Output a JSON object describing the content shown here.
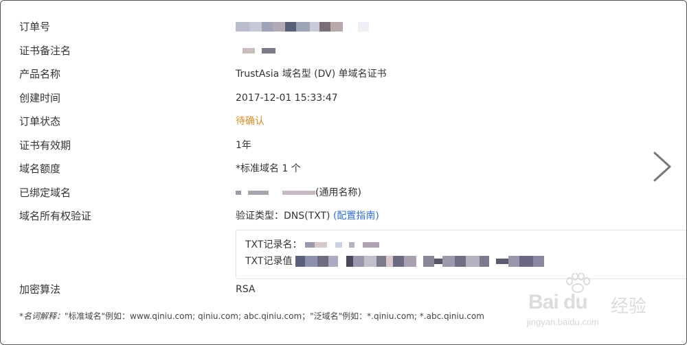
{
  "fields": {
    "order_no": {
      "label": "订单号"
    },
    "cert_note": {
      "label": "证书备注名"
    },
    "product": {
      "label": "产品名称",
      "value": "TrustAsia 域名型 (DV) 单域名证书"
    },
    "created": {
      "label": "创建时间",
      "value": "2017-12-01 15:33:47"
    },
    "status": {
      "label": "订单状态",
      "value": "待确认",
      "color": "#e08b1e"
    },
    "validity": {
      "label": "证书有效期",
      "value": "1年"
    },
    "quota": {
      "label": "域名额度",
      "value": "*标准域名 1 个"
    },
    "bound": {
      "label": "已绑定域名",
      "suffix": "(通用名称)"
    },
    "ownership": {
      "label": "域名所有权验证",
      "value": "验证类型：DNS(TXT)",
      "link": "(配置指南)",
      "link_color": "#2f6fe0"
    },
    "algorithm": {
      "label": "加密算法",
      "value": "RSA"
    }
  },
  "dns_box": {
    "txt_name_label": "TXT记录名：",
    "txt_value_label": "TXT记录值"
  },
  "footnote": {
    "prefix": "*名词解释：",
    "body": "\"标准域名\"例如：www.qiniu.com; qiniu.com; abc.qiniu.com；\"泛域名\"例如：*.qiniu.com; *.abc.qiniu.com"
  },
  "icons": {
    "next": "chevron-right-icon"
  },
  "watermark": {
    "brand": "Bai du",
    "cn": "经验",
    "url": "jingyan.baidu.com"
  }
}
